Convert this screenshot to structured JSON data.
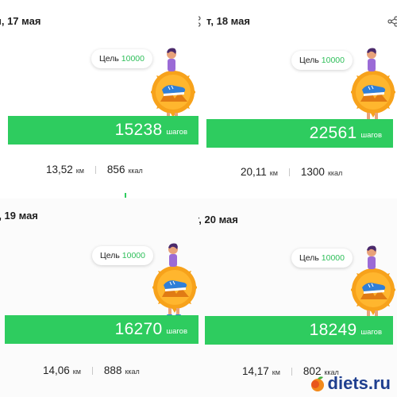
{
  "panels": [
    {
      "date": "н, 17 мая",
      "goal_label": "Цель",
      "goal_value": "10000",
      "steps": "15238",
      "steps_unit": "шагов",
      "distance": "13,52",
      "distance_unit": "км",
      "calories": "856",
      "calories_unit": "ккал"
    },
    {
      "date": "т, 18 мая",
      "goal_label": "Цель",
      "goal_value": "10000",
      "steps": "22561",
      "steps_unit": "шагов",
      "distance": "20,11",
      "distance_unit": "км",
      "calories": "1300",
      "calories_unit": "ккал"
    },
    {
      "date": "), 19 мая",
      "goal_label": "Цель",
      "goal_value": "10000",
      "steps": "16270",
      "steps_unit": "шагов",
      "distance": "14,06",
      "distance_unit": "км",
      "calories": "888",
      "calories_unit": "ккал"
    },
    {
      "date": "г, 20 мая",
      "goal_label": "Цель",
      "goal_value": "10000",
      "steps": "18249",
      "steps_unit": "шагов",
      "distance": "14,17",
      "distance_unit": "км",
      "calories": "802",
      "calories_unit": "ккал"
    }
  ],
  "watermark": {
    "text": "diets.ru"
  },
  "icons": {
    "share": "share-icon",
    "mascot": "sun-mascot-illustration",
    "watermark_fruit": "peach-icon"
  },
  "colors": {
    "accent_green": "#2ecc5f",
    "goal_green": "#2fbf5a",
    "watermark_blue": "#1f3f8f"
  }
}
